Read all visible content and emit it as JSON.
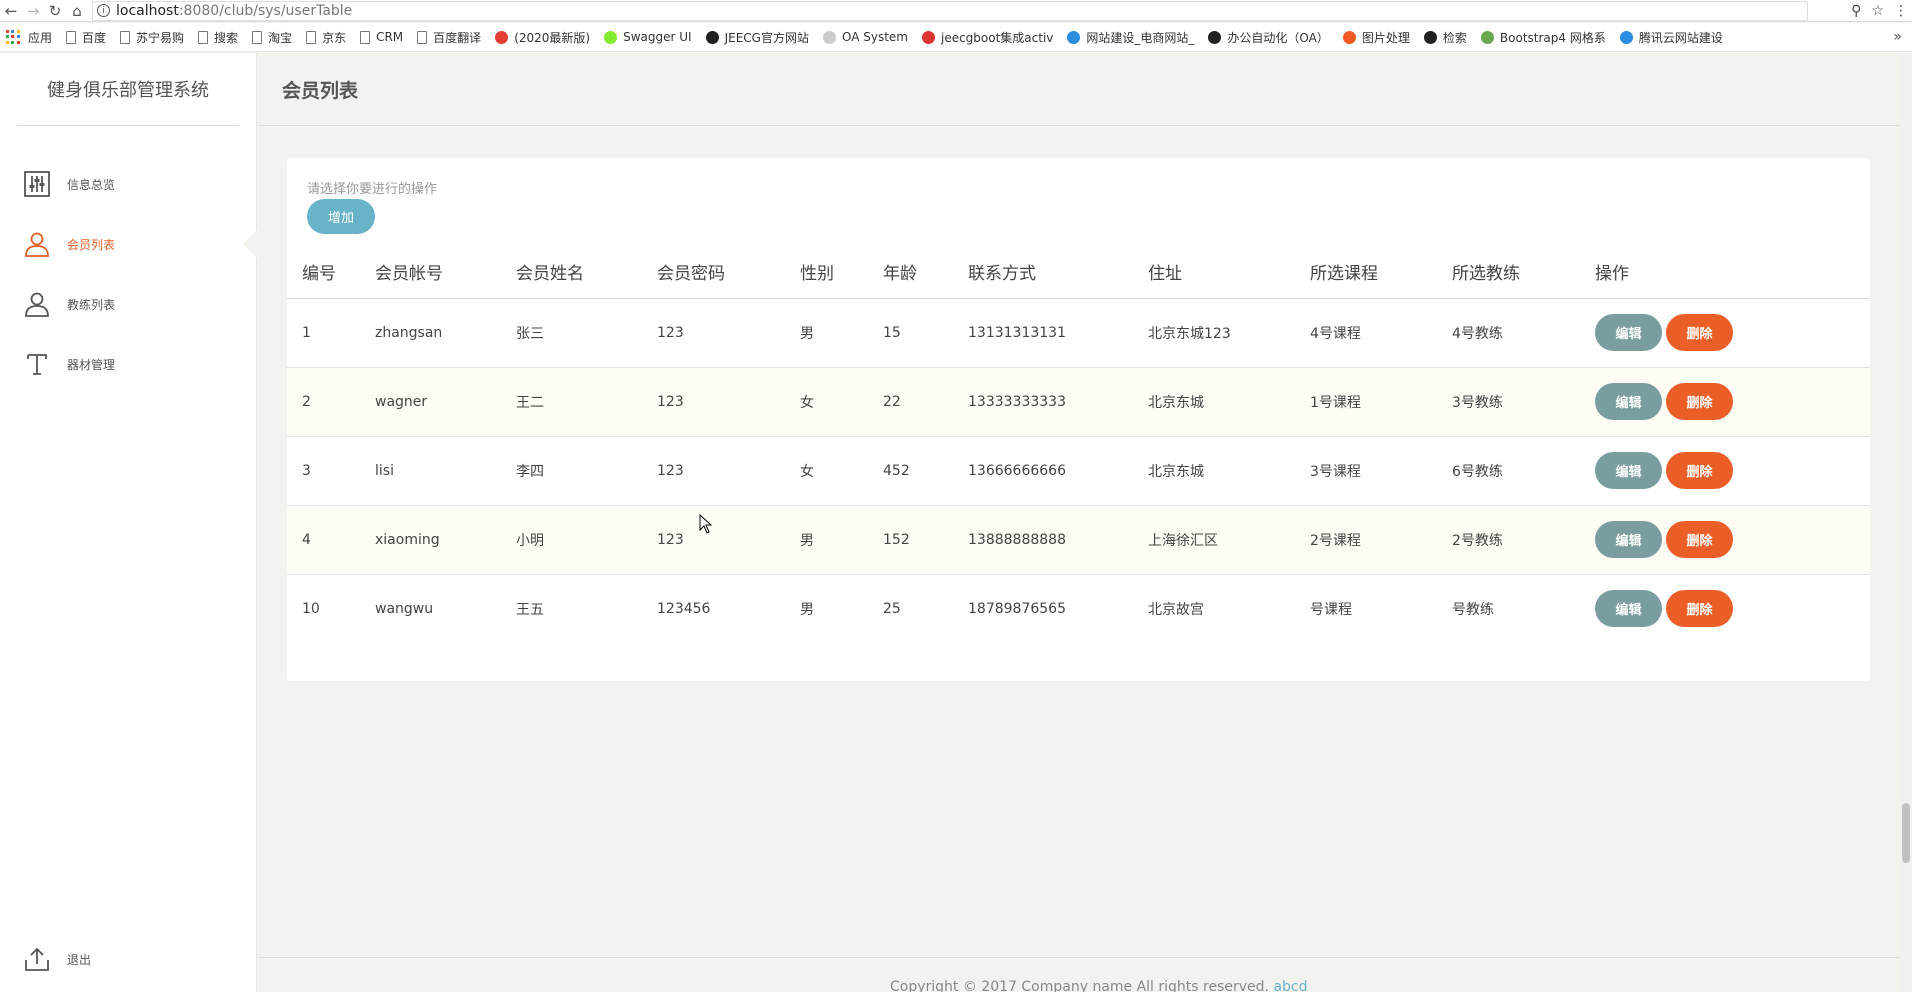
{
  "browser": {
    "url_host": "localhost",
    "url_path": ":8080/club/sys/userTable",
    "bookmarks": [
      {
        "label": "应用",
        "icon": "apps-icon"
      },
      {
        "label": "百度",
        "icon": "page-icon"
      },
      {
        "label": "苏宁易购",
        "icon": "page-icon"
      },
      {
        "label": "搜索",
        "icon": "page-icon"
      },
      {
        "label": "淘宝",
        "icon": "page-icon"
      },
      {
        "label": "京东",
        "icon": "page-icon"
      },
      {
        "label": "CRM",
        "icon": "page-icon"
      },
      {
        "label": "百度翻译",
        "icon": "page-icon"
      },
      {
        "label": "(2020最新版)",
        "icon": "csdn-icon"
      },
      {
        "label": "Swagger UI",
        "icon": "swagger-icon"
      },
      {
        "label": "JEECG官方网站",
        "icon": "jeecg-icon"
      },
      {
        "label": "OA System",
        "icon": "oa-icon"
      },
      {
        "label": "jeecgboot集成activ",
        "icon": "jeecgboot-icon"
      },
      {
        "label": "网站建设_电商网站_",
        "icon": "cloud-icon"
      },
      {
        "label": "办公自动化（OA）",
        "icon": "github-icon"
      },
      {
        "label": "图片处理",
        "icon": "image-icon"
      },
      {
        "label": "检索",
        "icon": "search-site-icon"
      },
      {
        "label": "Bootstrap4 网格系",
        "icon": "bootstrap-icon"
      },
      {
        "label": "腾讯云网站建设",
        "icon": "cloud-icon"
      }
    ]
  },
  "sidebar": {
    "brand": "健身俱乐部管理系统",
    "items": [
      {
        "label": "信息总览",
        "icon": "sliders-icon"
      },
      {
        "label": "会员列表",
        "icon": "user-icon"
      },
      {
        "label": "教练列表",
        "icon": "user-icon"
      },
      {
        "label": "器材管理",
        "icon": "text-icon"
      }
    ],
    "logout": "退出"
  },
  "page": {
    "title": "会员列表",
    "hint": "请选择你要进行的操作",
    "add_label": "增加"
  },
  "table": {
    "headers": [
      "编号",
      "会员帐号",
      "会员姓名",
      "会员密码",
      "性别",
      "年龄",
      "联系方式",
      "住址",
      "所选课程",
      "所选教练",
      "操作"
    ],
    "edit_label": "编辑",
    "delete_label": "删除",
    "rows": [
      [
        "1",
        "zhangsan",
        "张三",
        "123",
        "男",
        "15",
        "13131313131",
        "北京东城123",
        "4号课程",
        "4号教练"
      ],
      [
        "2",
        "wagner",
        "王二",
        "123",
        "女",
        "22",
        "13333333333",
        "北京东城",
        "1号课程",
        "3号教练"
      ],
      [
        "3",
        "lisi",
        "李四",
        "123",
        "女",
        "452",
        "13666666666",
        "北京东城",
        "3号课程",
        "6号教练"
      ],
      [
        "4",
        "xiaoming",
        "小明",
        "123",
        "男",
        "152",
        "13888888888",
        "上海徐汇区",
        "2号课程",
        "2号教练"
      ],
      [
        "10",
        "wangwu",
        "王五",
        "123456",
        "男",
        "25",
        "18789876565",
        "北京故宫",
        "号课程",
        "号教练"
      ]
    ]
  },
  "footer": {
    "text": "Copyright © 2017 Company name All rights reserved.",
    "link": "abcd"
  },
  "colors": {
    "accent_active": "#e0602a",
    "add_button": "#68b3c8",
    "edit_button": "#7a9e9f",
    "delete_button": "#eb5e28"
  }
}
